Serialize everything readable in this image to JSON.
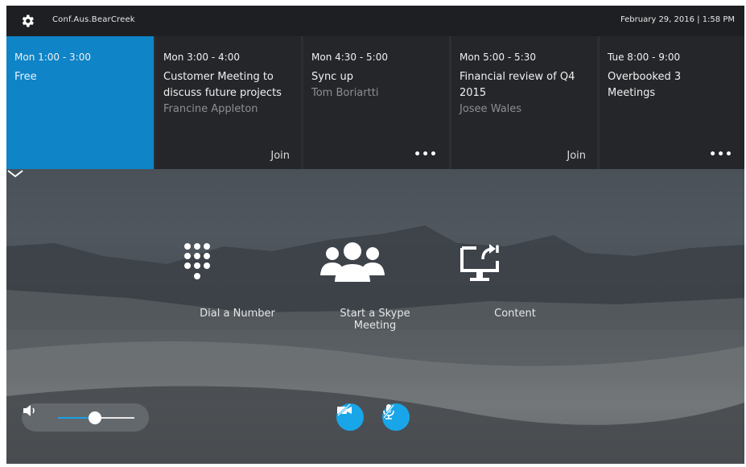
{
  "header": {
    "room_name": "Conf.Aus.BearCreek",
    "datetime": "February 29, 2016 | 1:58 PM"
  },
  "meetings": [
    {
      "time": "Mon 1:00 - 3:00",
      "subject": "Free",
      "organizer": "",
      "action": ""
    },
    {
      "time": "Mon 3:00 - 4:00",
      "subject": "Customer Meeting to discuss future projects",
      "organizer": "Francine Appleton",
      "action": "Join"
    },
    {
      "time": "Mon 4:30 - 5:00",
      "subject": "Sync up",
      "organizer": "Tom Boriartti",
      "action": "•••"
    },
    {
      "time": "Mon 5:00 - 5:30",
      "subject": "Financial review of Q4 2015",
      "organizer": "Josee Wales",
      "action": "Join"
    },
    {
      "time": "Tue 8:00 - 9:00",
      "subject": "Overbooked 3 Meetings",
      "organizer": "",
      "action": "•••"
    }
  ],
  "actions": {
    "dial": "Dial a Number",
    "skype": "Start a Skype Meeting",
    "content": "Content"
  },
  "volume": {
    "level": 0.48
  },
  "colors": {
    "accent": "#0f84c7",
    "button": "#19a6e8",
    "tile_bg": "#24262a",
    "topbar_bg": "#1d1f22"
  },
  "icons": {
    "settings": "gear-icon",
    "dial": "keypad-icon",
    "skype": "people-icon",
    "content": "monitor-share-icon",
    "video": "video-off-icon",
    "mic": "mic-off-icon",
    "expand": "chevron-down-icon",
    "volume": "speaker-icon"
  }
}
